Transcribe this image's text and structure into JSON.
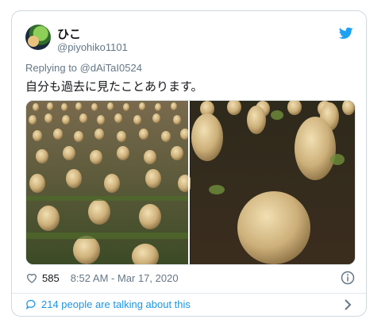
{
  "tweet": {
    "display_name": "ひこ",
    "handle": "@piyohiko1101",
    "replying_prefix": "Replying to",
    "replying_to": "@dAiTaI0524",
    "text": "自分も過去に見たことあります。",
    "likes": "585",
    "timestamp": "8:52 AM - Mar 17, 2020",
    "talking": "214 people are talking about this"
  },
  "icons": {
    "brand": "twitter-bird-icon",
    "like": "heart-icon",
    "info": "info-icon",
    "conversation": "speech-bubble-icon",
    "more": "chevron-right-icon"
  },
  "colors": {
    "brand_blue": "#1da1f2",
    "link_blue": "#1b95e0",
    "muted": "#657786",
    "border": "#cfd9de"
  }
}
